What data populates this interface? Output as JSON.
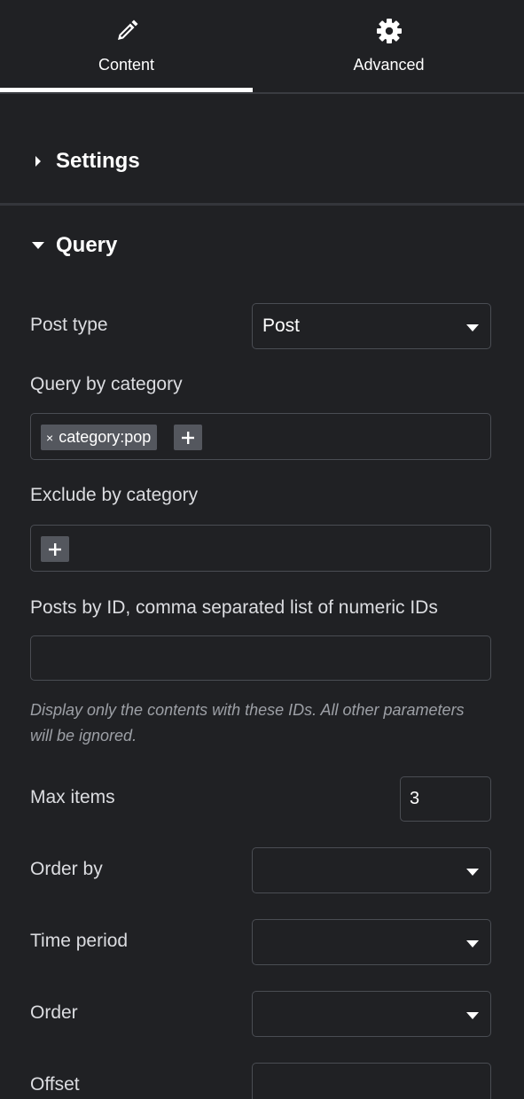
{
  "tabs": {
    "content": {
      "label": "Content",
      "icon": "pencil-icon",
      "active": true
    },
    "advanced": {
      "label": "Advanced",
      "icon": "gear-icon"
    }
  },
  "sections": {
    "settings": {
      "title": "Settings",
      "expanded": false
    },
    "query": {
      "title": "Query",
      "expanded": true
    }
  },
  "query": {
    "post_type": {
      "label": "Post type",
      "value": "Post"
    },
    "query_by_category": {
      "label": "Query by category",
      "tags": [
        "category:pop"
      ],
      "remove_glyph": "×"
    },
    "exclude_by_category": {
      "label": "Exclude by category",
      "tags": []
    },
    "posts_by_id": {
      "label": "Posts by ID, comma separated list of numeric IDs",
      "value": "",
      "help": "Display only the contents with these IDs. All other parameters will be ignored."
    },
    "max_items": {
      "label": "Max items",
      "value": "3"
    },
    "order_by": {
      "label": "Order by",
      "value": ""
    },
    "time_period": {
      "label": "Time period",
      "value": ""
    },
    "order": {
      "label": "Order",
      "value": ""
    },
    "offset": {
      "label": "Offset",
      "value": ""
    }
  },
  "colors": {
    "background": "#202124",
    "border": "#4a4d53",
    "tag_bg": "#54575e",
    "active_tab_underline": "#ffffff",
    "help_text": "#9da0a6"
  }
}
